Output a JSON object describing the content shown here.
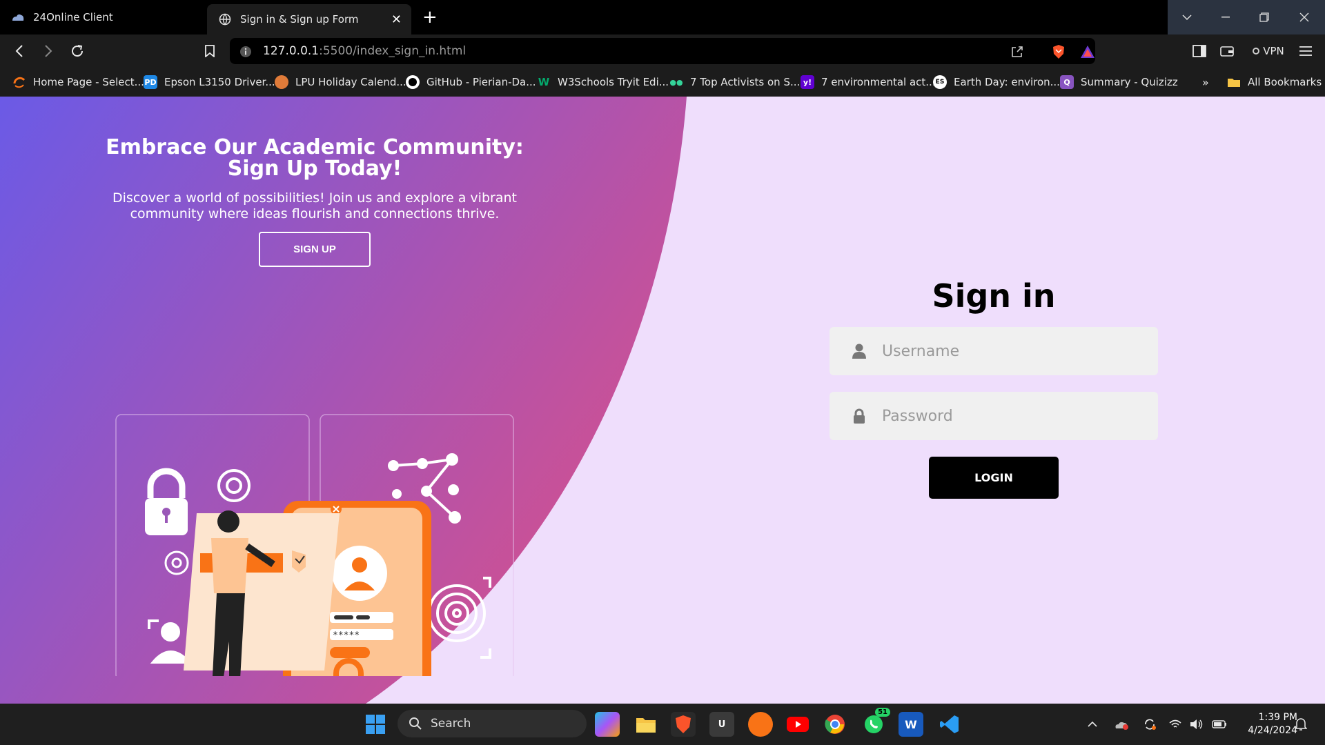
{
  "browser": {
    "tabs": [
      {
        "title": "24Online Client"
      },
      {
        "title": "Sign in & Sign up Form"
      }
    ],
    "url_host": "127.0.0.1",
    "url_path": ":5500/index_sign_in.html",
    "vpn_label": "VPN",
    "bookmarks": [
      {
        "label": "Home Page - Select..."
      },
      {
        "label": "Epson L3150 Driver..."
      },
      {
        "label": "LPU Holiday Calend..."
      },
      {
        "label": "GitHub - Pierian-Da..."
      },
      {
        "label": "W3Schools Tryit Edi..."
      },
      {
        "label": "7 Top Activists on S..."
      },
      {
        "label": "7 environmental act..."
      },
      {
        "label": "Earth Day: environ..."
      },
      {
        "label": "Summary - Quizizz"
      }
    ],
    "more_bookmarks": "»",
    "all_bookmarks": "All Bookmarks"
  },
  "page": {
    "left": {
      "heading": "Embrace Our Academic Community: Sign Up Today!",
      "description": "Discover a world of possibilities! Join us and explore a vibrant community where ideas flourish and connections thrive.",
      "signup_label": "SIGN UP"
    },
    "form": {
      "title": "Sign in",
      "username_placeholder": "Username",
      "password_placeholder": "Password",
      "login_label": "LOGIN"
    },
    "illustration": {
      "password_mask": "*****"
    },
    "colors": {
      "gradient_start": "#6b5ae6",
      "gradient_end": "#d3508f",
      "background": "#efdefc",
      "accent_orange": "#f97316"
    }
  },
  "taskbar": {
    "search_label": "Search",
    "whatsapp_badge": "51",
    "time": "1:39 PM",
    "date": "4/24/2024"
  }
}
